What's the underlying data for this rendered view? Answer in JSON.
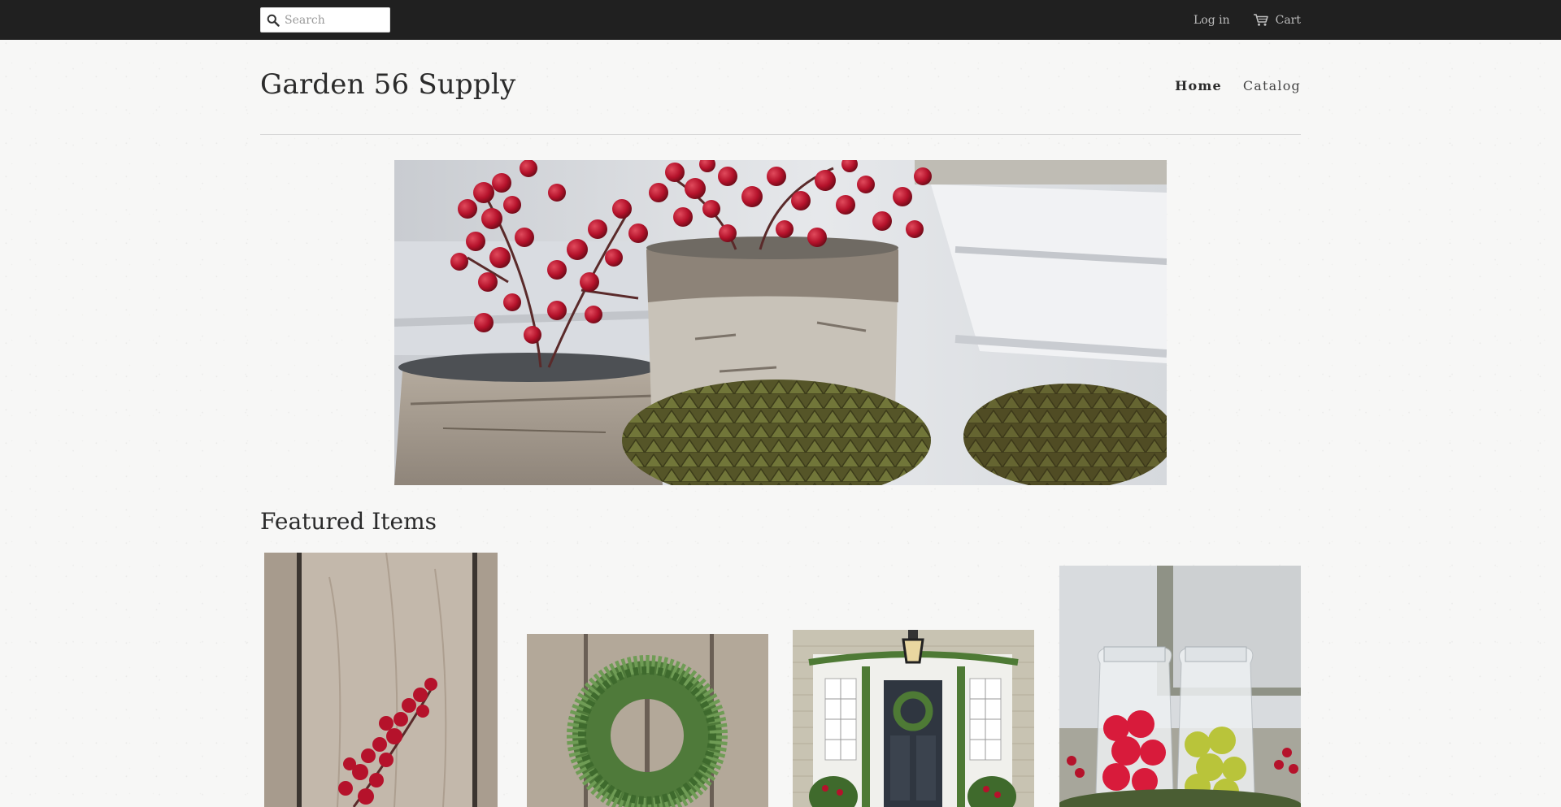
{
  "search": {
    "placeholder": "Search"
  },
  "account": {
    "login_label": "Log in",
    "cart_label": "Cart"
  },
  "site": {
    "title": "Garden 56 Supply"
  },
  "nav": {
    "items": [
      {
        "label": "Home",
        "active": true
      },
      {
        "label": "Catalog",
        "active": false
      }
    ]
  },
  "featured": {
    "heading": "Featured Items"
  },
  "colors": {
    "topbar": "#202020",
    "berry": "#b5122b",
    "text": "#2b2b2b"
  },
  "icons": {
    "search": "search-icon",
    "cart": "cart-icon"
  }
}
